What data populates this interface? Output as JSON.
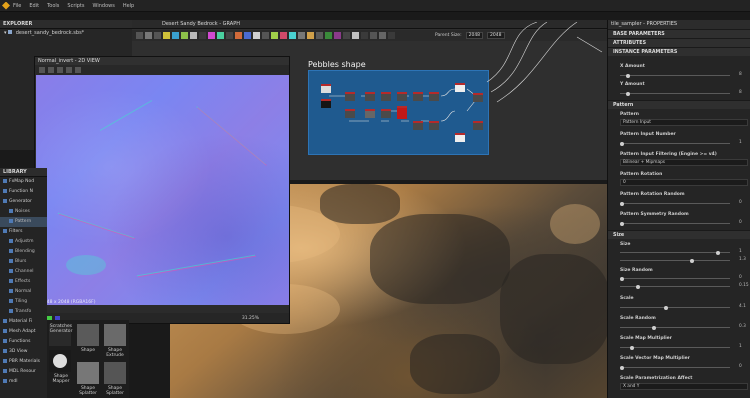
{
  "menubar": {
    "items": [
      "File",
      "Edit",
      "Tools",
      "Scripts",
      "Windows",
      "Help"
    ]
  },
  "explorer": {
    "title": "EXPLORER",
    "items": [
      "desert_sandy_bedrock.sbs*"
    ]
  },
  "library": {
    "title": "LIBRARY",
    "items": [
      {
        "label": "FxMap Nod",
        "sub": false
      },
      {
        "label": "Function N",
        "sub": false
      },
      {
        "label": "Generator",
        "sub": false
      },
      {
        "label": "Noises",
        "sub": true
      },
      {
        "label": "Pattern",
        "sub": true
      },
      {
        "label": "Filters",
        "sub": false
      },
      {
        "label": "Adjustm",
        "sub": true
      },
      {
        "label": "Blending",
        "sub": true
      },
      {
        "label": "Blurs",
        "sub": true
      },
      {
        "label": "Channel",
        "sub": true
      },
      {
        "label": "Effects",
        "sub": true
      },
      {
        "label": "Normal",
        "sub": true
      },
      {
        "label": "Tiling",
        "sub": true
      },
      {
        "label": "Transfo",
        "sub": true
      },
      {
        "label": "Material Fi",
        "sub": false
      },
      {
        "label": "Mesh Adapt",
        "sub": false
      },
      {
        "label": "Functions",
        "sub": false
      },
      {
        "label": "3D View",
        "sub": false
      },
      {
        "label": "PBR Materials",
        "sub": false
      },
      {
        "label": "MDL Resour",
        "sub": false
      },
      {
        "label": "mdl",
        "sub": false
      }
    ],
    "thumbs": [
      {
        "label": "Scratches Generator"
      },
      {
        "label": "Shape"
      },
      {
        "label": "Shape Extrude"
      },
      {
        "label": "Shape Mapper"
      },
      {
        "label": "Shape Splatter"
      },
      {
        "label": "Shape Splatter"
      }
    ]
  },
  "view2d": {
    "title": "Normal_invert - 2D VIEW",
    "info": "2048 x 2048 (RGBA16F)",
    "zoom": "31.25%"
  },
  "graph": {
    "title": "Desert Sandy Bedrock - GRAPH",
    "parent_size_label": "Parent Size:",
    "size_x": "2048",
    "size_y": "2048",
    "frame_title": "Pebbles shape"
  },
  "properties": {
    "title": "tile_sampler - PROPERTIES",
    "sections": [
      "BASE PARAMETERS",
      "ATTRIBUTES",
      "INSTANCE PARAMETERS"
    ],
    "y_amount": "Y Amount",
    "y_amount_value": "8",
    "x_amount": "X Amount",
    "x_amount_value": "8",
    "pattern_section": "Pattern",
    "pattern_label": "Pattern",
    "pattern_value": "Pattern Input",
    "pattern_input_number": "Pattern Input Number",
    "pattern_input_number_value": "1",
    "pattern_input_filtering": "Pattern Input Filtering (Engine >= v4)",
    "pattern_input_filtering_value": "Bilinear + Mipmaps",
    "pattern_rotation": "Pattern Rotation",
    "pattern_rotation_value": "0",
    "pattern_rotation_random": "Pattern Rotation Random",
    "pattern_rotation_random_value": "0",
    "pattern_symmetry_random": "Pattern Symmetry Random",
    "pattern_symmetry_random_value": "0",
    "size_section": "Size",
    "size_label": "Size",
    "size_x": "1",
    "size_y": "1.3",
    "size_random": "Size Random",
    "size_random_x": "0",
    "size_random_y": "0.15",
    "scale": "Scale",
    "scale_value": "4.1",
    "scale_random": "Scale Random",
    "scale_random_value": "0.3",
    "scale_map_multiplier": "Scale Map Multiplier",
    "scale_map_multiplier_value": "1",
    "scale_vector_map_multiplier": "Scale Vector Map Multiplier",
    "scale_vector_map_multiplier_value": "0",
    "scale_param_affect": "Scale Parametrization Affect",
    "scale_param_affect_value": "X and Y"
  }
}
